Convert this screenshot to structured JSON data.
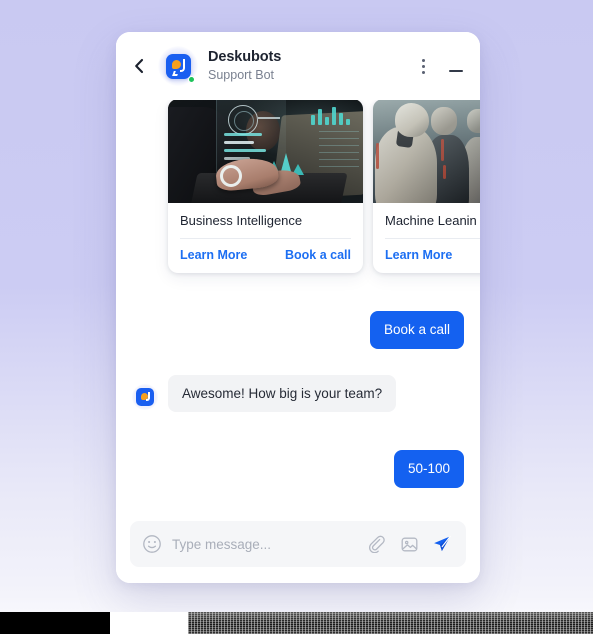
{
  "header": {
    "title": "Deskubots",
    "subtitle": "Support Bot",
    "back_icon": "chevron-left-icon",
    "avatar_icon": "deskubots-logo-icon",
    "status": "online",
    "menu_icon": "kebab-menu-icon",
    "minimize_icon": "minimize-icon"
  },
  "cards": [
    {
      "title": "Business Intelligence",
      "image_alt": "person-typing-on-laptop-with-data-overlay",
      "links": [
        "Learn More",
        "Book a call"
      ]
    },
    {
      "title": "Machine Leanin",
      "image_alt": "humanoid-robots-row",
      "links": [
        "Learn More"
      ]
    }
  ],
  "messages": [
    {
      "id": "m1",
      "from": "user",
      "text": "Book a call"
    },
    {
      "id": "m2",
      "from": "bot",
      "text": "Awesome! How big is your team?"
    },
    {
      "id": "m3",
      "from": "user",
      "text": "50-100"
    }
  ],
  "composer": {
    "placeholder": "Type message...",
    "value": "",
    "emoji_icon": "smiley-icon",
    "attach_icon": "paperclip-icon",
    "image_icon": "image-icon",
    "send_icon": "send-paper-plane-icon"
  },
  "colors": {
    "accent_blue": "#1461f0",
    "link_blue": "#1d6ff2",
    "bot_bubble": "#f2f3f5",
    "page_background": "#ccccf3",
    "status_green": "#1ec35a"
  }
}
